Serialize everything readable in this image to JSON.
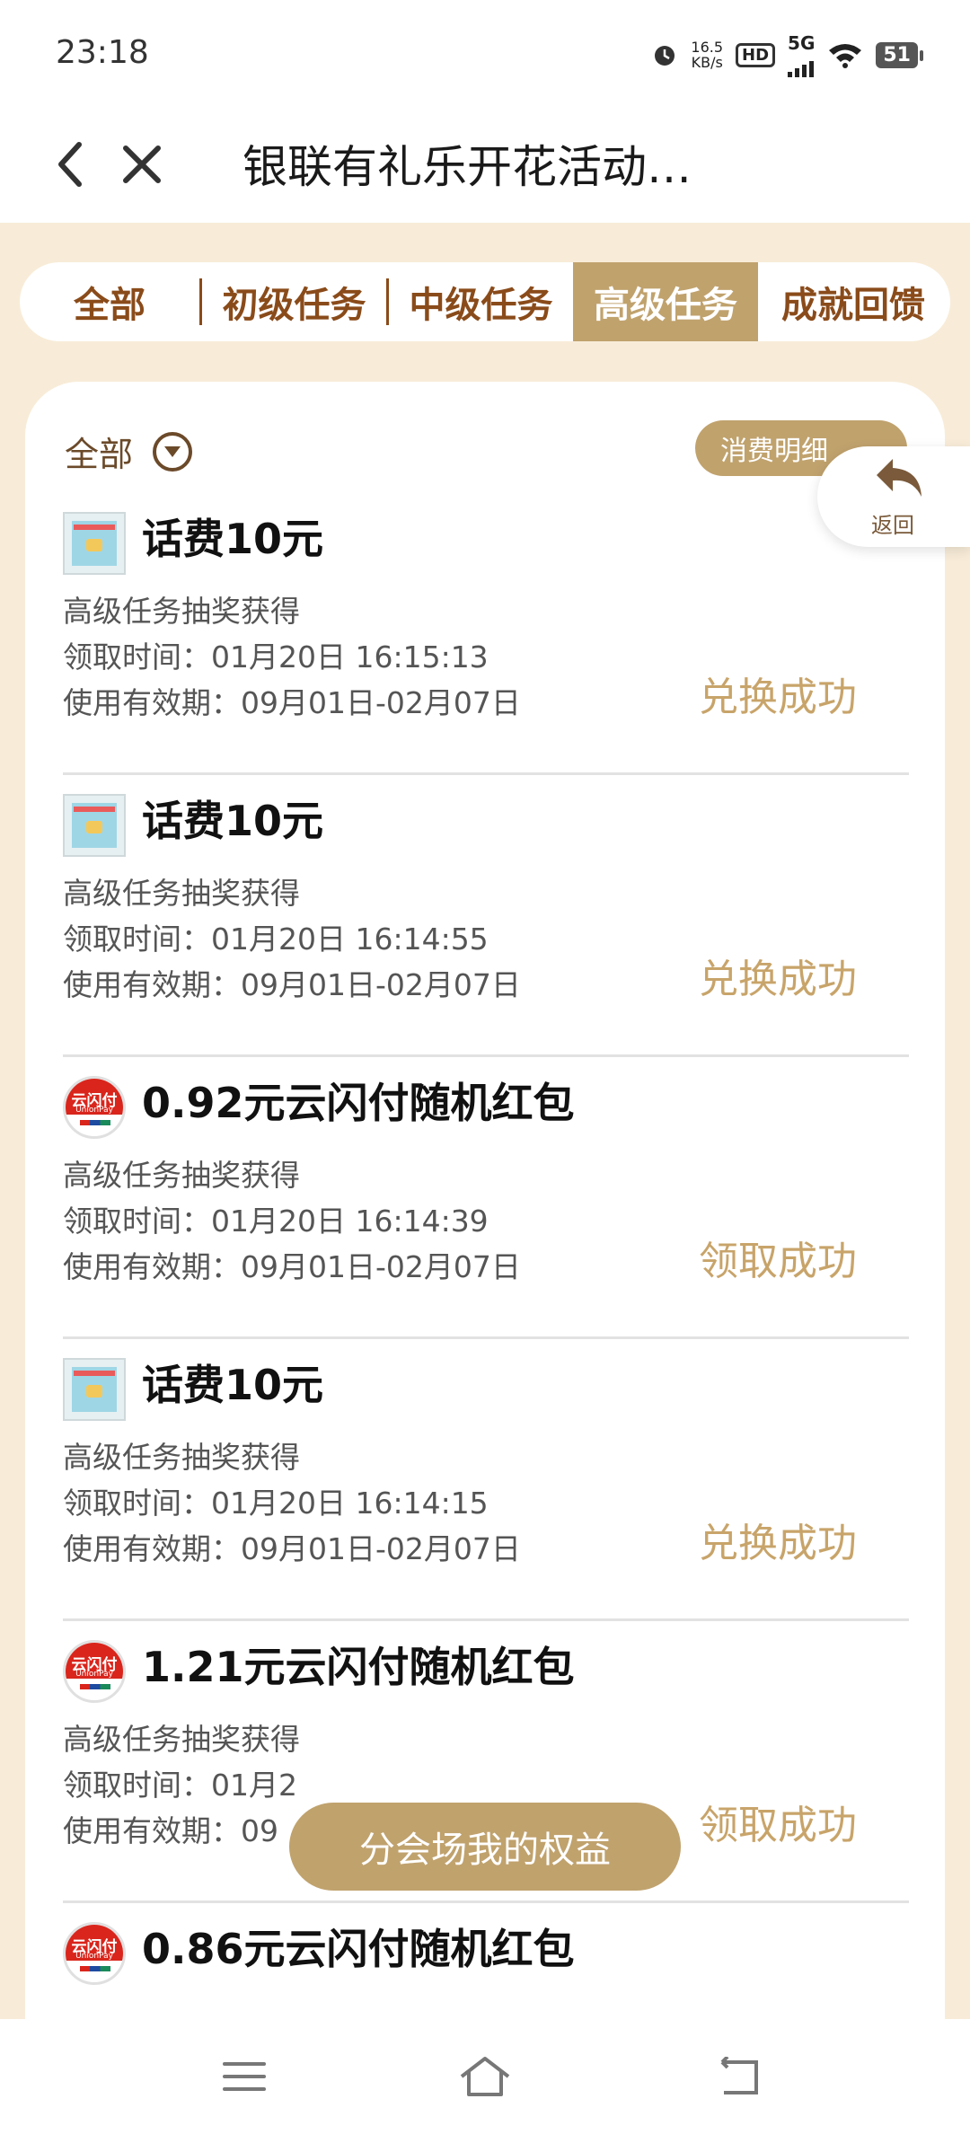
{
  "status_bar": {
    "time": "23:18",
    "net_speed_value": "16.5",
    "net_speed_unit": "KB/s",
    "hd": "HD",
    "network": "5G",
    "battery": "51"
  },
  "nav": {
    "title": "银联有礼乐开花活动…"
  },
  "tabs": [
    {
      "label": "全部"
    },
    {
      "label": "初级任务"
    },
    {
      "label": "中级任务"
    },
    {
      "label": "高级任务"
    },
    {
      "label": "成就回馈"
    }
  ],
  "active_tab": "高级任务",
  "filter": {
    "label": "全部",
    "detail_button": "消费明细"
  },
  "items": [
    {
      "icon": "phone-credit-icon",
      "title": "话费10元",
      "source": "高级任务抽奖获得",
      "received": "领取时间：01月20日 16:15:13",
      "validity": "使用有效期：09月01日-02月07日",
      "status": "兑换成功"
    },
    {
      "icon": "phone-credit-icon",
      "title": "话费10元",
      "source": "高级任务抽奖获得",
      "received": "领取时间：01月20日 16:14:55",
      "validity": "使用有效期：09月01日-02月07日",
      "status": "兑换成功"
    },
    {
      "icon": "unionpay-icon",
      "title": "0.92元云闪付随机红包",
      "source": "高级任务抽奖获得",
      "received": "领取时间：01月20日 16:14:39",
      "validity": "使用有效期：09月01日-02月07日",
      "status": "领取成功"
    },
    {
      "icon": "phone-credit-icon",
      "title": "话费10元",
      "source": "高级任务抽奖获得",
      "received": "领取时间：01月20日 16:14:15",
      "validity": "使用有效期：09月01日-02月07日",
      "status": "兑换成功"
    },
    {
      "icon": "unionpay-icon",
      "title": "1.21元云闪付随机红包",
      "source": "高级任务抽奖获得",
      "received": "领取时间：01月2",
      "validity": "使用有效期：09",
      "status": "领取成功"
    },
    {
      "icon": "unionpay-icon",
      "title": "0.86元云闪付随机红包",
      "source": "",
      "received": "",
      "validity": "",
      "status": ""
    }
  ],
  "floating_back": {
    "label": "返回"
  },
  "floating_button": {
    "label": "分会场我的权益"
  },
  "unionpay_logo": {
    "text": "云闪付",
    "sub": "UnionPay"
  },
  "colors": {
    "accent": "#c0a26d",
    "tab_text": "#8a4b1a",
    "background": "#f8ecd8",
    "status": "#c8a46a"
  }
}
